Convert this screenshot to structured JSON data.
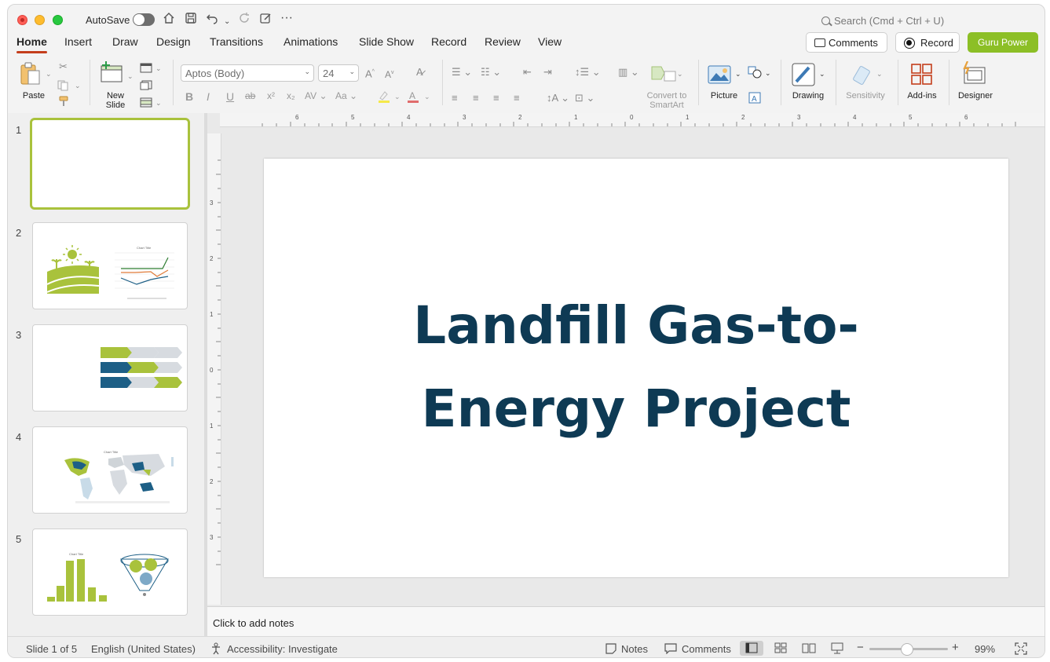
{
  "titlebar": {
    "autosave_label": "AutoSave",
    "search_placeholder": "Search (Cmd + Ctrl + U)"
  },
  "menu": {
    "tabs": [
      "Home",
      "Insert",
      "Draw",
      "Design",
      "Transitions",
      "Animations",
      "Slide Show",
      "Record",
      "Review",
      "View"
    ],
    "active_tab": "Home",
    "comments_label": "Comments",
    "record_label": "Record",
    "guru_label": "Guru Power"
  },
  "ribbon": {
    "paste_label": "Paste",
    "new_slide_label_1": "New",
    "new_slide_label_2": "Slide",
    "font_name": "Aptos (Body)",
    "font_size": "24",
    "convert_label_1": "Convert to",
    "convert_label_2": "SmartArt",
    "picture_label": "Picture",
    "drawing_label": "Drawing",
    "sensitivity_label": "Sensitivity",
    "addins_label": "Add-ins",
    "designer_label": "Designer"
  },
  "slides": {
    "numbers": [
      "1",
      "2",
      "3",
      "4",
      "5"
    ],
    "thumb2_chart_title": "Chart Title",
    "thumb4_chart_title": "Chart Title",
    "thumb5_chart_title": "Chart Title"
  },
  "ruler": {
    "h_labels": [
      "6",
      "5",
      "4",
      "3",
      "2",
      "1",
      "0",
      "1",
      "2",
      "3",
      "4",
      "5",
      "6"
    ],
    "v_labels": [
      "3",
      "2",
      "1",
      "0",
      "1",
      "2",
      "3"
    ]
  },
  "slide_main": {
    "title_line1": "Landfill Gas-to-",
    "title_line2": "Energy Project",
    "title_color": "#0e3a54"
  },
  "notes": {
    "placeholder": "Click to add notes"
  },
  "status": {
    "slide_position": "Slide 1 of 5",
    "language": "English (United States)",
    "accessibility": "Accessibility: Investigate",
    "notes_label": "Notes",
    "comments_label": "Comments",
    "zoom": "99%"
  },
  "colors": {
    "accent_green": "#8cbf26",
    "dark_blue": "#0e3a54",
    "active_tab_underline": "#c43e1c",
    "thumb_green": "#a9c23c",
    "thumb_blue": "#1d5f86"
  }
}
